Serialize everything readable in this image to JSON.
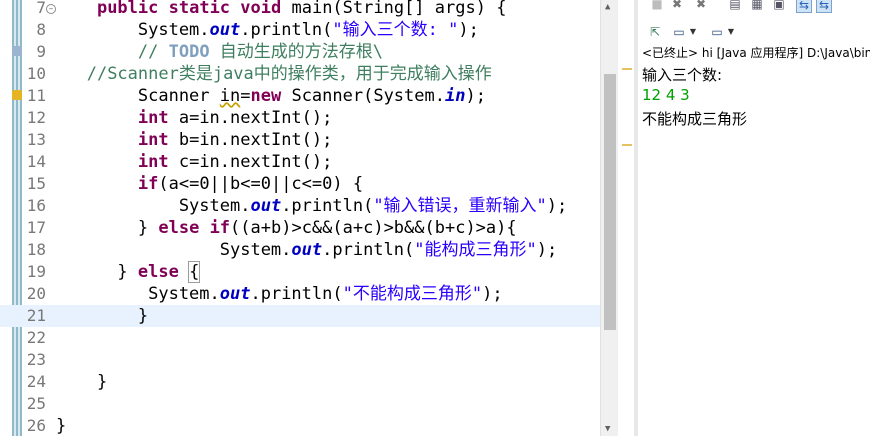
{
  "editor": {
    "lines": [
      {
        "n": "7",
        "parts": [
          {
            "t": "    "
          },
          {
            "t": "public",
            "c": "kw"
          },
          {
            "t": " "
          },
          {
            "t": "static",
            "c": "kw"
          },
          {
            "t": " "
          },
          {
            "t": "void",
            "c": "kw"
          },
          {
            "t": " main(String[] "
          },
          {
            "t": "args",
            "c": "plain"
          },
          {
            "t": ") {"
          }
        ],
        "fold": true
      },
      {
        "n": "8",
        "parts": [
          {
            "t": "        System."
          },
          {
            "t": "out",
            "c": "fld"
          },
          {
            "t": ".println("
          },
          {
            "t": "\"输入三个数: \"",
            "c": "st"
          },
          {
            "t": ");"
          }
        ]
      },
      {
        "n": "9",
        "parts": [
          {
            "t": "        "
          },
          {
            "t": "// ",
            "c": "cm"
          },
          {
            "t": "TODO",
            "c": "todo"
          },
          {
            "t": " 自动生成的方法存根\\",
            "c": "cm"
          }
        ],
        "task": true
      },
      {
        "n": "10",
        "parts": [
          {
            "t": "   "
          },
          {
            "t": "//Scanner类是java中的操作类，用于完成输入操作",
            "c": "cm"
          }
        ]
      },
      {
        "n": "11",
        "parts": [
          {
            "t": "        Scanner "
          },
          {
            "t": "in",
            "c": "ul"
          },
          {
            "t": "="
          },
          {
            "t": "new",
            "c": "kw"
          },
          {
            "t": " Scanner(System."
          },
          {
            "t": "in",
            "c": "fld"
          },
          {
            "t": ");"
          }
        ],
        "warn": true
      },
      {
        "n": "12",
        "parts": [
          {
            "t": "        "
          },
          {
            "t": "int",
            "c": "kw"
          },
          {
            "t": " a=in.nextInt();"
          }
        ]
      },
      {
        "n": "13",
        "parts": [
          {
            "t": "        "
          },
          {
            "t": "int",
            "c": "kw"
          },
          {
            "t": " b=in.nextInt();"
          }
        ]
      },
      {
        "n": "14",
        "parts": [
          {
            "t": "        "
          },
          {
            "t": "int",
            "c": "kw"
          },
          {
            "t": " c=in.nextInt();"
          }
        ]
      },
      {
        "n": "15",
        "parts": [
          {
            "t": "        "
          },
          {
            "t": "if",
            "c": "kw"
          },
          {
            "t": "(a<=0||b<=0||c<=0) {"
          }
        ]
      },
      {
        "n": "16",
        "parts": [
          {
            "t": "            System."
          },
          {
            "t": "out",
            "c": "fld"
          },
          {
            "t": ".println("
          },
          {
            "t": "\"输入错误，重新输入\"",
            "c": "st"
          },
          {
            "t": ");"
          }
        ]
      },
      {
        "n": "17",
        "parts": [
          {
            "t": "        } "
          },
          {
            "t": "else",
            "c": "kw"
          },
          {
            "t": " "
          },
          {
            "t": "if",
            "c": "kw"
          },
          {
            "t": "((a+b)>c&&(a+c)>b&&(b+c)>a){"
          }
        ]
      },
      {
        "n": "18",
        "parts": [
          {
            "t": "                System."
          },
          {
            "t": "out",
            "c": "fld"
          },
          {
            "t": ".println("
          },
          {
            "t": "\"能构成三角形\"",
            "c": "st"
          },
          {
            "t": ");"
          }
        ]
      },
      {
        "n": "19",
        "parts": [
          {
            "t": "      } "
          },
          {
            "t": "else",
            "c": "kw"
          },
          {
            "t": " "
          },
          {
            "t": "{",
            "c": "br"
          }
        ]
      },
      {
        "n": "20",
        "parts": [
          {
            "t": "         System."
          },
          {
            "t": "out",
            "c": "fld"
          },
          {
            "t": ".println("
          },
          {
            "t": "\"不能构成三角形\"",
            "c": "st"
          },
          {
            "t": ");"
          }
        ]
      },
      {
        "n": "21",
        "parts": [
          {
            "t": "        }"
          }
        ],
        "current": true
      },
      {
        "n": "22",
        "parts": [
          {
            "t": ""
          }
        ]
      },
      {
        "n": "23",
        "parts": [
          {
            "t": ""
          }
        ]
      },
      {
        "n": "24",
        "parts": [
          {
            "t": "    }"
          }
        ]
      },
      {
        "n": "25",
        "parts": [
          {
            "t": ""
          }
        ]
      },
      {
        "n": "26",
        "parts": [
          {
            "t": "}"
          }
        ]
      }
    ]
  },
  "console": {
    "status": "<已终止> hi [Java 应用程序] D:\\Java\\bin\\",
    "output": [
      {
        "text": "输入三个数:",
        "type": "out"
      },
      {
        "text": "12 4 3",
        "type": "input"
      },
      {
        "text": "不能构成三角形",
        "type": "out"
      }
    ],
    "icons": {
      "row1": [
        "stop-icon",
        "remove-launch-icon",
        "remove-all-icon",
        "scroll-lock-icon",
        "word-wrap-icon",
        "show-console-icon",
        "pin-console-icon"
      ],
      "row2": [
        "open-console-icon",
        "display-selected-console-icon",
        "new-console-icon"
      ]
    }
  },
  "colors": {
    "keyword": "#7f0055",
    "string": "#2a00ff",
    "comment": "#3f7f5f",
    "field": "#0000c0",
    "input": "#00a000"
  }
}
